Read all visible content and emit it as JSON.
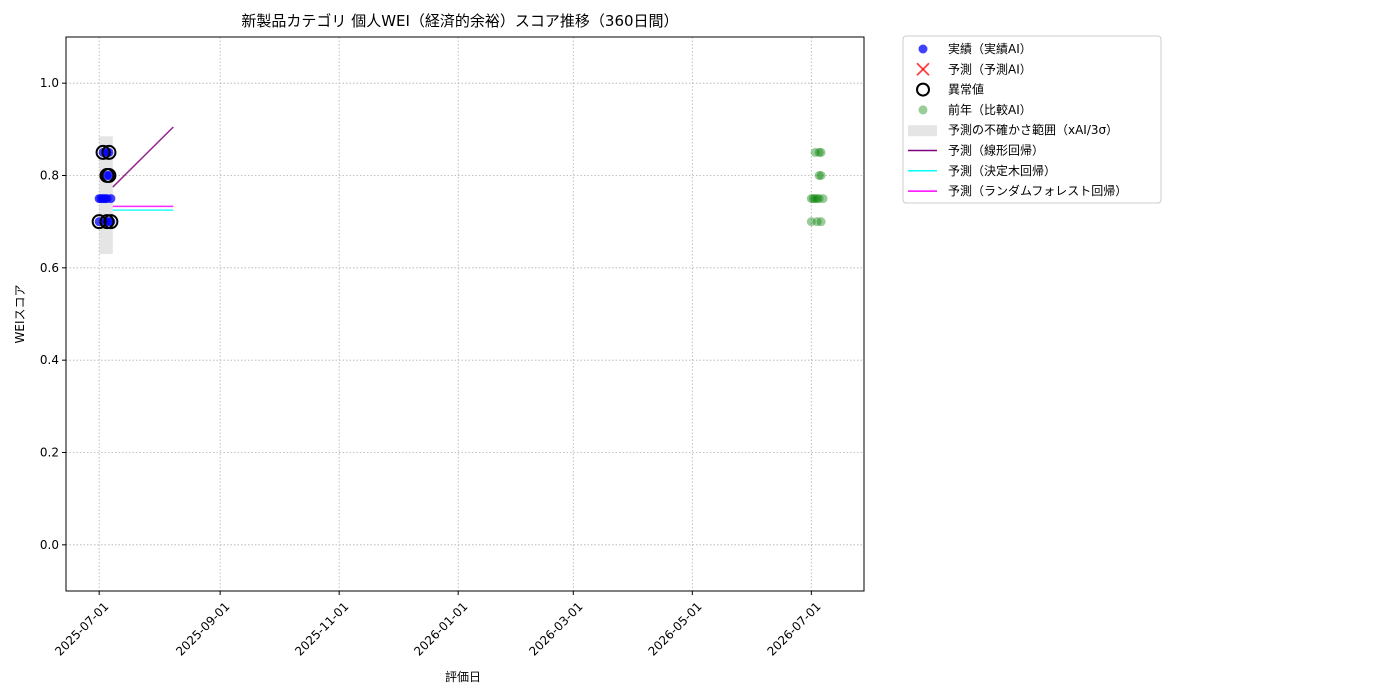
{
  "chart_data": {
    "type": "scatter",
    "title": "新製品カテゴリ 個人WEI（経済的余裕）スコア推移（360日間）",
    "xlabel": "評価日",
    "ylabel": "WEIスコア",
    "xlim": [
      "2025-06-14",
      "2026-07-28"
    ],
    "ylim": [
      -0.1,
      1.1
    ],
    "grid": true,
    "legend_position": "outside-right-top",
    "x_ticks": [
      "2025-07-01",
      "2025-09-01",
      "2025-11-01",
      "2026-01-01",
      "2026-03-01",
      "2026-05-01",
      "2026-07-01"
    ],
    "y_ticks": [
      0.0,
      0.2,
      0.4,
      0.6,
      0.8,
      1.0
    ],
    "colors": {
      "actual": "#0000ff",
      "forecast": "#ff0000",
      "anomaly": "#000000",
      "previous_year": "#008000",
      "uncertainty": "#d3d3d3",
      "linear": "#800080",
      "decision_tree": "#00ffff",
      "random_forest": "#ff00ff"
    },
    "legend": [
      {
        "key": "actual",
        "label": "実績（実績AI）",
        "marker": "circle"
      },
      {
        "key": "forecast",
        "label": "予測（予測AI）",
        "marker": "x"
      },
      {
        "key": "anomaly",
        "label": "異常値",
        "marker": "ring"
      },
      {
        "key": "previous_year",
        "label": "前年（比較AI）",
        "marker": "circle-light"
      },
      {
        "key": "uncertainty",
        "label": "予測の不確かさ範囲（xAI/3σ）",
        "marker": "band"
      },
      {
        "key": "linear",
        "label": "予測（線形回帰）",
        "marker": "line"
      },
      {
        "key": "decision_tree",
        "label": "予測（決定木回帰）",
        "marker": "line"
      },
      {
        "key": "random_forest",
        "label": "予測（ランダムフォレスト回帰）",
        "marker": "line"
      }
    ],
    "series": [
      {
        "key": "actual",
        "points": [
          {
            "x": "2025-07-01",
            "y": 0.7
          },
          {
            "x": "2025-07-01",
            "y": 0.75
          },
          {
            "x": "2025-07-02",
            "y": 0.75
          },
          {
            "x": "2025-07-03",
            "y": 0.85
          },
          {
            "x": "2025-07-03",
            "y": 0.75
          },
          {
            "x": "2025-07-04",
            "y": 0.7
          },
          {
            "x": "2025-07-04",
            "y": 0.75
          },
          {
            "x": "2025-07-05",
            "y": 0.8
          },
          {
            "x": "2025-07-05",
            "y": 0.85
          },
          {
            "x": "2025-07-05",
            "y": 0.75
          },
          {
            "x": "2025-07-06",
            "y": 0.7
          },
          {
            "x": "2025-07-06",
            "y": 0.8
          },
          {
            "x": "2025-07-06",
            "y": 0.85
          },
          {
            "x": "2025-07-07",
            "y": 0.75
          },
          {
            "x": "2025-07-07",
            "y": 0.7
          }
        ]
      },
      {
        "key": "anomaly",
        "points": [
          {
            "x": "2025-07-01",
            "y": 0.7
          },
          {
            "x": "2025-07-03",
            "y": 0.85
          },
          {
            "x": "2025-07-05",
            "y": 0.8
          },
          {
            "x": "2025-07-05",
            "y": 0.7
          },
          {
            "x": "2025-07-06",
            "y": 0.85
          },
          {
            "x": "2025-07-06",
            "y": 0.8
          },
          {
            "x": "2025-07-07",
            "y": 0.7
          }
        ]
      },
      {
        "key": "previous_year",
        "points": [
          {
            "x": "2026-07-01",
            "y": 0.7
          },
          {
            "x": "2026-07-01",
            "y": 0.75
          },
          {
            "x": "2026-07-02",
            "y": 0.75
          },
          {
            "x": "2026-07-03",
            "y": 0.85
          },
          {
            "x": "2026-07-03",
            "y": 0.75
          },
          {
            "x": "2026-07-04",
            "y": 0.7
          },
          {
            "x": "2026-07-04",
            "y": 0.75
          },
          {
            "x": "2026-07-05",
            "y": 0.8
          },
          {
            "x": "2026-07-05",
            "y": 0.85
          },
          {
            "x": "2026-07-05",
            "y": 0.75
          },
          {
            "x": "2026-07-06",
            "y": 0.7
          },
          {
            "x": "2026-07-06",
            "y": 0.8
          },
          {
            "x": "2026-07-06",
            "y": 0.85
          },
          {
            "x": "2026-07-07",
            "y": 0.75
          }
        ]
      }
    ],
    "uncertainty_band": {
      "x_start": "2025-07-01",
      "x_end": "2025-07-08",
      "y_low": 0.63,
      "y_high": 0.885
    },
    "forecast_lines": [
      {
        "key": "linear",
        "points": [
          {
            "x": "2025-07-08",
            "y": 0.775
          },
          {
            "x": "2025-08-08",
            "y": 0.905
          }
        ]
      },
      {
        "key": "decision_tree",
        "points": [
          {
            "x": "2025-07-08",
            "y": 0.725
          },
          {
            "x": "2025-08-08",
            "y": 0.725
          }
        ]
      },
      {
        "key": "random_forest",
        "points": [
          {
            "x": "2025-07-08",
            "y": 0.733
          },
          {
            "x": "2025-08-08",
            "y": 0.733
          }
        ]
      }
    ]
  }
}
